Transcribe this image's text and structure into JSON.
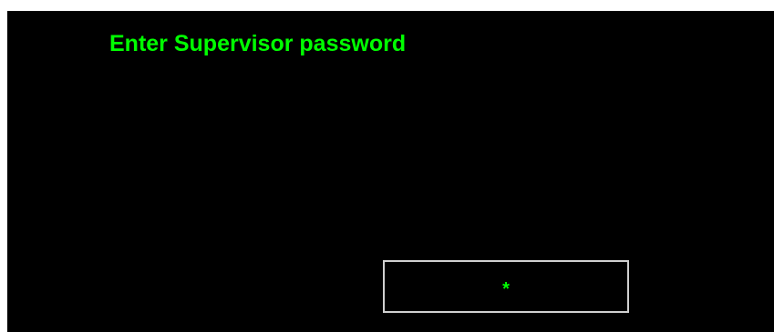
{
  "prompt": {
    "title": "Enter Supervisor password"
  },
  "password_field": {
    "masked_value": "*"
  },
  "colors": {
    "text": "#00ff00",
    "background": "#000000",
    "field_border": "#d0d0d0"
  }
}
